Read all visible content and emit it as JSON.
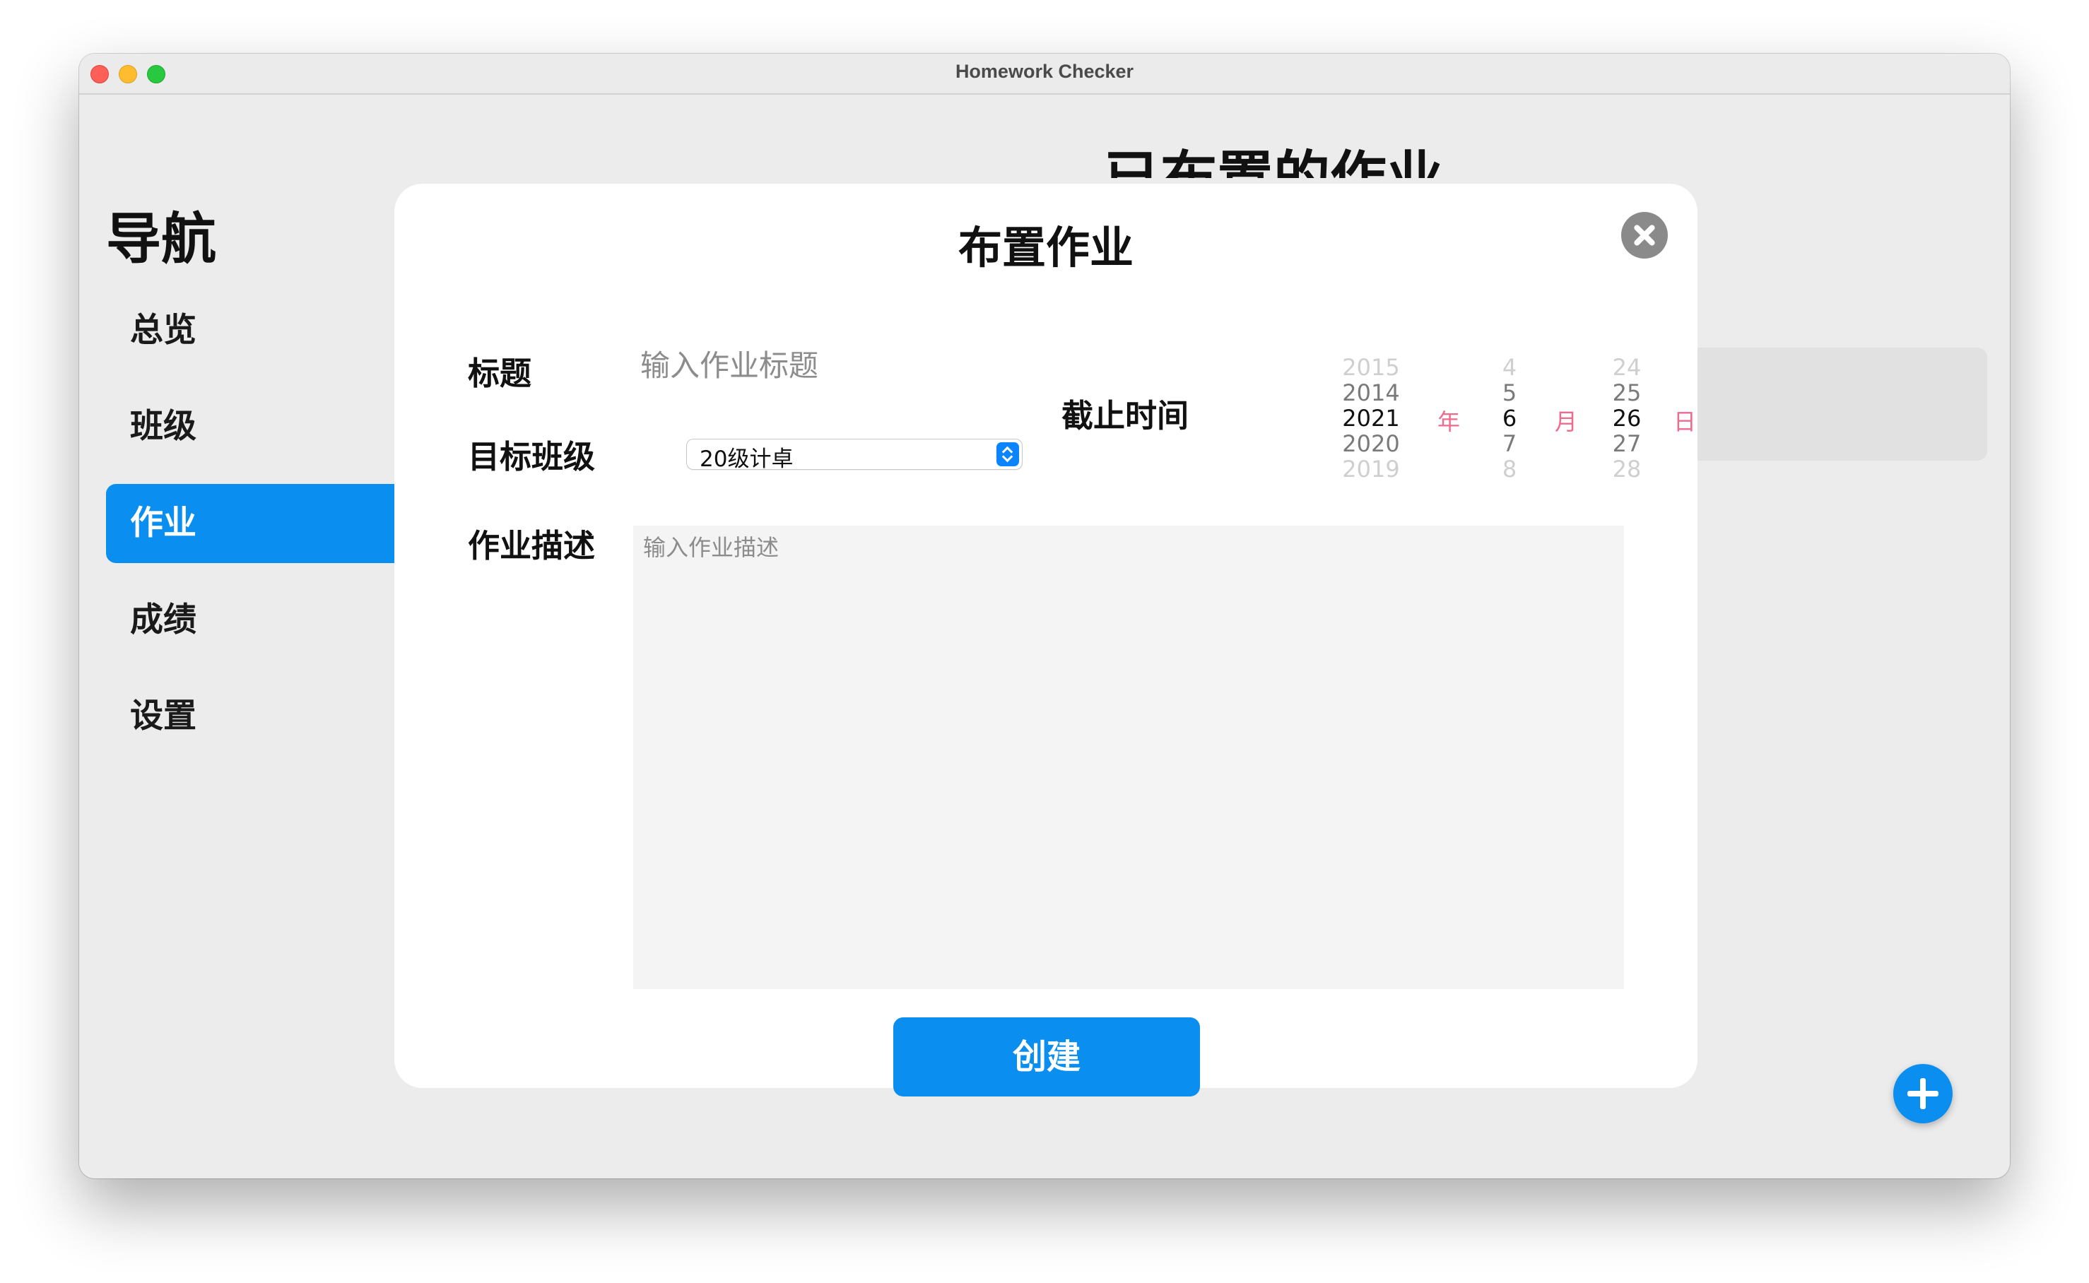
{
  "window": {
    "title": "Homework Checker"
  },
  "nav": {
    "heading": "导航",
    "items": [
      {
        "label": "总览",
        "active": false
      },
      {
        "label": "班级",
        "active": false
      },
      {
        "label": "作业",
        "active": true
      },
      {
        "label": "成绩",
        "active": false
      },
      {
        "label": "设置",
        "active": false
      }
    ]
  },
  "background": {
    "page_title": "已布置的作业"
  },
  "modal": {
    "title": "布置作业",
    "title_label": "标题",
    "title_placeholder": "输入作业标题",
    "class_label": "目标班级",
    "class_value": "20级计卓",
    "deadline_label": "截止时间",
    "desc_label": "作业描述",
    "desc_placeholder": "输入作业描述",
    "create_label": "创建",
    "date_picker": {
      "year": {
        "rows": [
          "2015",
          "2014",
          "2021",
          "2020",
          "2019"
        ],
        "selected": "2021",
        "unit": "年"
      },
      "month": {
        "rows": [
          "4",
          "5",
          "6",
          "7",
          "8"
        ],
        "selected": "6",
        "unit": "月"
      },
      "day": {
        "rows": [
          "24",
          "25",
          "26",
          "27",
          "28"
        ],
        "selected": "26",
        "unit": "日"
      }
    }
  },
  "colors": {
    "accent": "#0a8ff0",
    "unit_pink": "#f06a8e",
    "close_gray": "#8a8a8a"
  }
}
